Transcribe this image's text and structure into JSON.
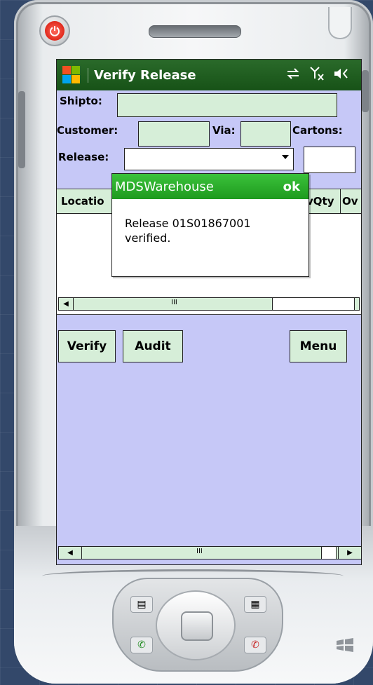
{
  "window": {
    "title": "Verify Release"
  },
  "form": {
    "shipto_label": "Shipto:",
    "shipto_value": "",
    "customer_label": "Customer:",
    "customer_value": "",
    "via_label": "Via:",
    "via_value": "",
    "cartons_label": "Cartons:",
    "cartons_value": "",
    "release_label": "Release:",
    "release_value": "",
    "release_qty_value": ""
  },
  "grid": {
    "columns": [
      "Locatio",
      "vQty",
      "Ov"
    ],
    "rows": [],
    "scroll_mark": "III"
  },
  "buttons": {
    "verify": "Verify",
    "audit": "Audit",
    "menu": "Menu"
  },
  "bottom_scroll": {
    "mark": "III"
  },
  "dialog": {
    "title": "MDSWarehouse",
    "ok_label": "ok",
    "message": "Release 01S01867001 verified."
  },
  "icons": {
    "start": "windows-flag-icon",
    "connectivity": "sync-arrows-icon",
    "signal": "no-signal-icon",
    "volume": "speaker-icon",
    "power": "power-icon"
  },
  "colors": {
    "status_bar": "#175217",
    "form_background": "#c6c8f7",
    "field_fill": "#d6eed8",
    "dialog_header": "#1e9a1e",
    "power_red": "#e0291c"
  }
}
